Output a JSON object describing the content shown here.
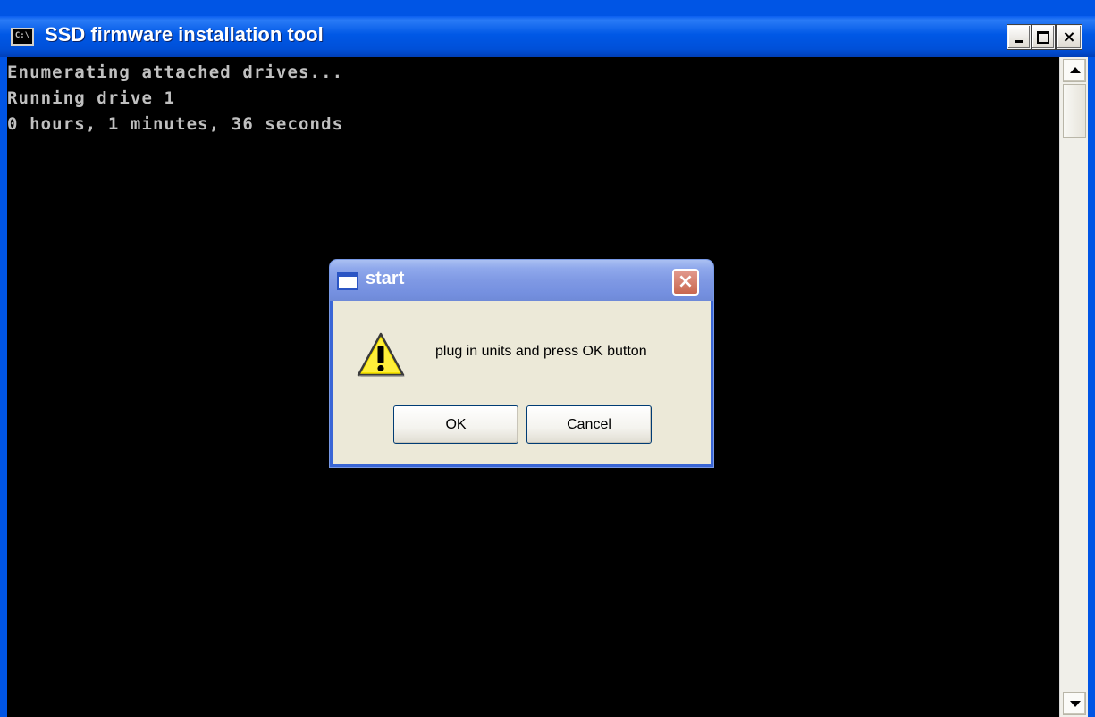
{
  "window": {
    "title": "SSD firmware installation tool",
    "icon_text": "C:\\",
    "icon": "console-icon",
    "controls": {
      "minimize_icon": "minimize-icon",
      "maximize_icon": "maximize-icon",
      "close_label": "×"
    }
  },
  "console": {
    "lines": [
      "Enumerating attached drives...",
      "Running drive 1",
      "0 hours, 1 minutes, 36 seconds"
    ],
    "background": "#000000",
    "text_color": "#c0c0c0"
  },
  "dialog": {
    "title": "start",
    "close_label": "×",
    "icon": "warning-icon",
    "message": "plug in units and press OK button",
    "ok_label": "OK",
    "cancel_label": "Cancel"
  },
  "colors": {
    "titlebar": "#0055e5",
    "dialog_titlebar": "#7f99e4",
    "dialog_body": "#ece9d8",
    "close_button": "#c9674f"
  }
}
